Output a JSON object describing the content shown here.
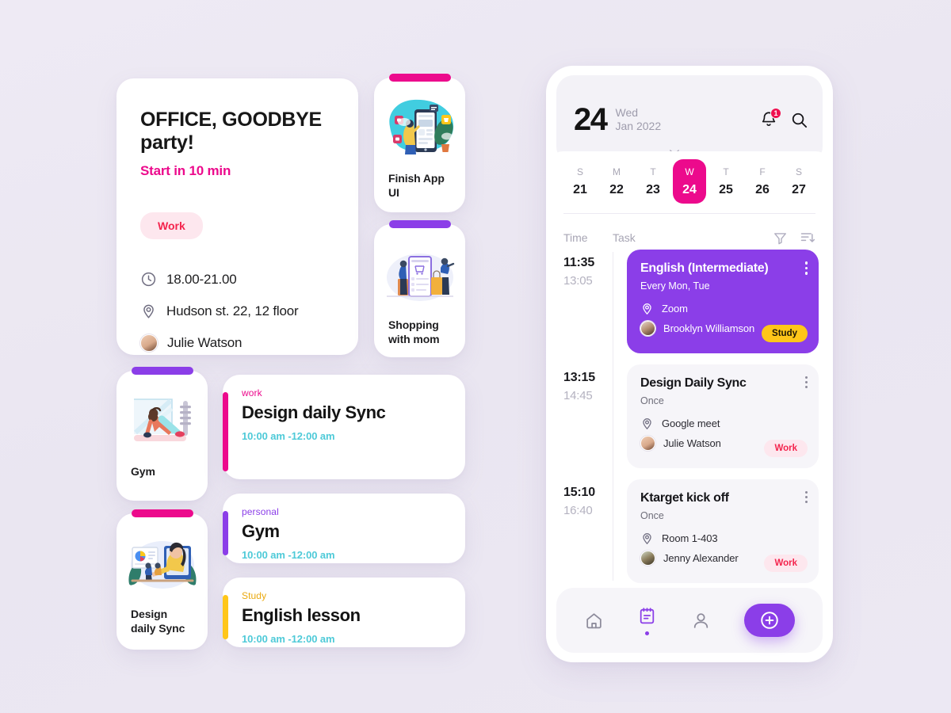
{
  "hero": {
    "title": "OFFICE, GOODBYE party!",
    "subtitle": "Start in 10 min",
    "badge": "Work",
    "time": "18.00-21.00",
    "location": "Hudson st. 22, 12 floor",
    "person": "Julie Watson",
    "accent_color": "#ec0a8c",
    "badge_bg": "#fde7ee",
    "badge_fg": "#f4244d"
  },
  "illustration_cards": [
    {
      "id": "finish",
      "label": "Finish App UI",
      "tab_color": "#ec0a8c"
    },
    {
      "id": "shop",
      "label": "Shopping with mom",
      "tab_color": "#8b3ee8"
    },
    {
      "id": "gym",
      "label": "Gym",
      "tab_color": "#8b3ee8"
    },
    {
      "id": "design",
      "label": "Design daily Sync",
      "tab_color": "#ec0a8c"
    }
  ],
  "task_cards": [
    {
      "category": "work",
      "name": "Design daily Sync",
      "time": "10:00 am -12:00 am",
      "color": "#ec0a8c"
    },
    {
      "category": "personal",
      "name": "Gym",
      "time": "10:00 am -12:00 am",
      "color": "#8b3ee8"
    },
    {
      "category": "Study",
      "name": "English lesson",
      "time": "10:00 am -12:00 am",
      "color": "#ffc619"
    }
  ],
  "phone": {
    "header": {
      "day_number": "24",
      "day_of_week": "Wed",
      "month_year": "Jan 2022",
      "notification_count": "1"
    },
    "week": [
      {
        "letter": "S",
        "number": "21",
        "active": false
      },
      {
        "letter": "M",
        "number": "22",
        "active": false
      },
      {
        "letter": "T",
        "number": "23",
        "active": false
      },
      {
        "letter": "W",
        "number": "24",
        "active": true
      },
      {
        "letter": "T",
        "number": "25",
        "active": false
      },
      {
        "letter": "F",
        "number": "26",
        "active": false
      },
      {
        "letter": "S",
        "number": "27",
        "active": false
      }
    ],
    "list_header": {
      "time_label": "Time",
      "task_label": "Task"
    },
    "rows": [
      {
        "start": "11:35",
        "end": "13:05",
        "title": "English (Intermediate)",
        "repeat": "Every Mon, Tue",
        "location": "Zoom",
        "person": "Brooklyn Williamson",
        "tag": "Study",
        "tag_style": "study",
        "highlight": true
      },
      {
        "start": "13:15",
        "end": "14:45",
        "title": "Design Daily Sync",
        "repeat": "Once",
        "location": "Google meet",
        "person": "Julie Watson",
        "tag": "Work",
        "tag_style": "work",
        "highlight": false
      },
      {
        "start": "15:10",
        "end": "16:40",
        "title": "Ktarget kick off",
        "repeat": "Once",
        "location": "Room 1-403",
        "person": "Jenny Alexander",
        "tag": "Work",
        "tag_style": "work",
        "highlight": false
      }
    ],
    "nav": [
      {
        "id": "home",
        "icon": "home-icon",
        "active": false
      },
      {
        "id": "calendar",
        "icon": "calendar-icon",
        "active": true
      },
      {
        "id": "profile",
        "icon": "person-icon",
        "active": false
      },
      {
        "id": "add",
        "icon": "plus-icon",
        "active": false
      }
    ]
  },
  "theme": {
    "background": "#ece8f2",
    "pink": "#ec0a8c",
    "purple": "#8b3ee8",
    "teal": "#4ecad8",
    "yellow": "#ffc619",
    "red": "#f4244d"
  }
}
